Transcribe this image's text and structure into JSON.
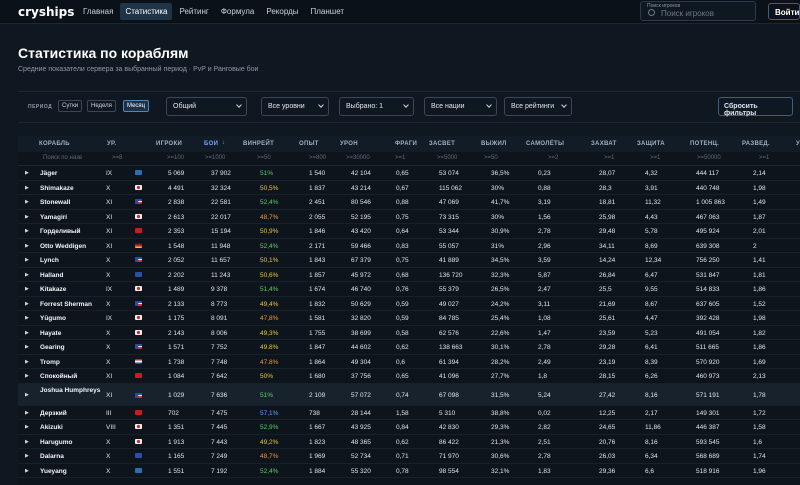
{
  "topbar": {
    "logo": "cryships",
    "nav": [
      "Главная",
      "Статистика",
      "Рейтинг",
      "Формула",
      "Рекорды",
      "Планшет"
    ],
    "active_nav": 1,
    "search_label": "Поиск игроков",
    "search_placeholder": "Поиск игроков",
    "login": "Войти"
  },
  "page": {
    "title": "Статистика по кораблям",
    "subtitle": "Средние показатели сервера за выбранный период · PvP и Ранговые бои"
  },
  "filters": {
    "period_label": "ПЕРИОД",
    "periods": [
      "Сутки",
      "Неделя",
      "Месяц"
    ],
    "active_period": 2,
    "selects": [
      "Общий",
      "Все уровни",
      "Выбрано: 1",
      "Все нации",
      "Все рейтинги"
    ],
    "reset": "Сбросить фильтры"
  },
  "table": {
    "headers": [
      "КОРАБЛЬ",
      "УР.",
      "ИГРОКИ",
      "БОИ",
      "ВИНРЕЙТ",
      "ОПЫТ",
      "УРОН",
      "ФРАГИ",
      "ЗАСВЕТ",
      "ВЫЖИЛ",
      "САМОЛЁТЫ",
      "ЗАХВАТ",
      "ЗАЩИТА",
      "ПОТЕНЦ.",
      "РАЗВЕД.",
      "У"
    ],
    "sort_arrow": "↓",
    "filters": [
      "Поиск по назв",
      ">=8",
      ">=100",
      ">=1000",
      ">=50",
      ">=800",
      ">=30000",
      ">=1",
      ">=5000",
      ">=50",
      ">=2",
      ">=1",
      ">=1",
      ">=50000",
      ">=1"
    ],
    "rows": [
      {
        "name": "Jäger",
        "tier": "IX",
        "flag": "pan-asia",
        "players": "5 069",
        "battles": "37 902",
        "wr": "51%",
        "wrc": "g",
        "exp": "1 540",
        "dmg": "42 104",
        "frags": "0,65",
        "spot": "53 074",
        "surv": "36,5%",
        "planes": "0,23",
        "cap": "28,07",
        "def": "4,32",
        "pot": "444 117",
        "scout": "2,14"
      },
      {
        "name": "Shimakaze",
        "tier": "X",
        "flag": "japan",
        "players": "4 491",
        "battles": "32 324",
        "wr": "50,5%",
        "wrc": "y",
        "exp": "1 837",
        "dmg": "43 214",
        "frags": "0,67",
        "spot": "115 062",
        "surv": "30%",
        "planes": "0,88",
        "cap": "28,3",
        "def": "3,91",
        "pot": "440 748",
        "scout": "1,98"
      },
      {
        "name": "Stonewall",
        "tier": "XI",
        "flag": "usa",
        "players": "2 838",
        "battles": "22 581",
        "wr": "52,4%",
        "wrc": "g",
        "exp": "2 451",
        "dmg": "80 546",
        "frags": "0,88",
        "spot": "47 069",
        "surv": "41,7%",
        "planes": "3,19",
        "cap": "18,81",
        "def": "11,32",
        "pot": "1 005 863",
        "scout": "1,49"
      },
      {
        "name": "Yamagiri",
        "tier": "XI",
        "flag": "japan",
        "players": "2 613",
        "battles": "22 017",
        "wr": "48,7%",
        "wrc": "o",
        "exp": "2 055",
        "dmg": "52 195",
        "frags": "0,75",
        "spot": "73 315",
        "surv": "30%",
        "planes": "1,56",
        "cap": "25,98",
        "def": "4,43",
        "pot": "467 063",
        "scout": "1,87"
      },
      {
        "name": "Горделивый",
        "tier": "XI",
        "flag": "ussr",
        "players": "2 353",
        "battles": "15 194",
        "wr": "50,9%",
        "wrc": "y",
        "exp": "1 846",
        "dmg": "43 420",
        "frags": "0,64",
        "spot": "53 344",
        "surv": "30,9%",
        "planes": "2,78",
        "cap": "29,48",
        "def": "5,78",
        "pot": "495 924",
        "scout": "2,01"
      },
      {
        "name": "Otto Weddigen",
        "tier": "XI",
        "flag": "germany",
        "players": "1 548",
        "battles": "11 948",
        "wr": "52,4%",
        "wrc": "g",
        "exp": "2 171",
        "dmg": "59 466",
        "frags": "0,83",
        "spot": "55 057",
        "surv": "31%",
        "planes": "2,96",
        "cap": "34,11",
        "def": "8,69",
        "pot": "639 308",
        "scout": "2"
      },
      {
        "name": "Lynch",
        "tier": "X",
        "flag": "usa",
        "players": "2 052",
        "battles": "11 657",
        "wr": "50,1%",
        "wrc": "y",
        "exp": "1 843",
        "dmg": "67 379",
        "frags": "0,75",
        "spot": "41 889",
        "surv": "34,5%",
        "planes": "3,59",
        "cap": "14,24",
        "def": "12,34",
        "pot": "756 250",
        "scout": "1,41"
      },
      {
        "name": "Halland",
        "tier": "X",
        "flag": "europe",
        "players": "2 202",
        "battles": "11 243",
        "wr": "50,6%",
        "wrc": "y",
        "exp": "1 857",
        "dmg": "45 972",
        "frags": "0,68",
        "spot": "136 720",
        "surv": "32,3%",
        "planes": "5,87",
        "cap": "26,84",
        "def": "6,47",
        "pot": "531 847",
        "scout": "1,81"
      },
      {
        "name": "Kitakaze",
        "tier": "IX",
        "flag": "japan",
        "players": "1 489",
        "battles": "9 378",
        "wr": "51,4%",
        "wrc": "g",
        "exp": "1 674",
        "dmg": "46 740",
        "frags": "0,76",
        "spot": "55 379",
        "surv": "26,5%",
        "planes": "2,47",
        "cap": "25,5",
        "def": "9,55",
        "pot": "514 833",
        "scout": "1,86"
      },
      {
        "name": "Forrest Sherman",
        "tier": "X",
        "flag": "usa",
        "players": "2 133",
        "battles": "8 773",
        "wr": "49,4%",
        "wrc": "y",
        "exp": "1 832",
        "dmg": "50 629",
        "frags": "0,59",
        "spot": "49 027",
        "surv": "24,2%",
        "planes": "3,11",
        "cap": "21,69",
        "def": "8,67",
        "pot": "637 605",
        "scout": "1,52"
      },
      {
        "name": "Yūgumo",
        "tier": "IX",
        "flag": "japan",
        "players": "1 175",
        "battles": "8 091",
        "wr": "47,8%",
        "wrc": "o",
        "exp": "1 581",
        "dmg": "32 820",
        "frags": "0,59",
        "spot": "84 785",
        "surv": "25,4%",
        "planes": "1,08",
        "cap": "25,61",
        "def": "4,47",
        "pot": "392 428",
        "scout": "1,98"
      },
      {
        "name": "Hayate",
        "tier": "X",
        "flag": "japan",
        "players": "2 143",
        "battles": "8 006",
        "wr": "49,3%",
        "wrc": "y",
        "exp": "1 755",
        "dmg": "38 699",
        "frags": "0,58",
        "spot": "62 576",
        "surv": "22,6%",
        "planes": "1,47",
        "cap": "23,59",
        "def": "5,23",
        "pot": "491 054",
        "scout": "1,82"
      },
      {
        "name": "Gearing",
        "tier": "X",
        "flag": "usa",
        "players": "1 571",
        "battles": "7 752",
        "wr": "49.8%",
        "wrc": "y",
        "exp": "1 847",
        "dmg": "44 602",
        "frags": "0,62",
        "spot": "138 663",
        "surv": "30,1%",
        "planes": "2,78",
        "cap": "29,28",
        "def": "6,41",
        "pot": "511 665",
        "scout": "1,86"
      },
      {
        "name": "Tromp",
        "tier": "X",
        "flag": "netherlands",
        "players": "1 738",
        "battles": "7 748",
        "wr": "47.8%",
        "wrc": "o",
        "exp": "1 864",
        "dmg": "49 304",
        "frags": "0,6",
        "spot": "61 394",
        "surv": "28,2%",
        "planes": "2,49",
        "cap": "23,19",
        "def": "8,39",
        "pot": "570 920",
        "scout": "1,69"
      },
      {
        "name": "Спокойный",
        "tier": "XI",
        "flag": "ussr",
        "players": "1 084",
        "battles": "7 642",
        "wr": "50%",
        "wrc": "y",
        "exp": "1 680",
        "dmg": "37 756",
        "frags": "0,65",
        "spot": "41 096",
        "surv": "27,7%",
        "planes": "1,8",
        "cap": "28,15",
        "def": "6,26",
        "pot": "460 973",
        "scout": "2,13"
      },
      {
        "name": "Joshua Humphreys",
        "tier": "XI",
        "flag": "usa",
        "players": "1 029",
        "battles": "7 636",
        "wr": "51%",
        "wrc": "g",
        "exp": "2 109",
        "dmg": "57 072",
        "frags": "0,74",
        "spot": "67 098",
        "surv": "31,5%",
        "planes": "5,24",
        "cap": "27,42",
        "def": "8,16",
        "pot": "571 191",
        "scout": "1,78",
        "hl": true
      },
      {
        "name": "Дерзкий",
        "tier": "III",
        "flag": "ussr",
        "players": "702",
        "battles": "7 475",
        "wr": "57,1%",
        "wrc": "b",
        "exp": "738",
        "dmg": "28 144",
        "frags": "1,58",
        "spot": "5 310",
        "surv": "38,8%",
        "planes": "0,02",
        "cap": "12,25",
        "def": "2,17",
        "pot": "149 301",
        "scout": "1,72"
      },
      {
        "name": "Akizuki",
        "tier": "VIII",
        "flag": "japan",
        "players": "1 351",
        "battles": "7 445",
        "wr": "52,9%",
        "wrc": "g",
        "exp": "1 667",
        "dmg": "43 925",
        "frags": "0,84",
        "spot": "42 830",
        "surv": "29,3%",
        "planes": "2,82",
        "cap": "24,65",
        "def": "11,86",
        "pot": "446 387",
        "scout": "1,58"
      },
      {
        "name": "Harugumo",
        "tier": "X",
        "flag": "japan",
        "players": "1 913",
        "battles": "7 443",
        "wr": "49,2%",
        "wrc": "y",
        "exp": "1 823",
        "dmg": "48 365",
        "frags": "0,62",
        "spot": "86 422",
        "surv": "21,3%",
        "planes": "2,51",
        "cap": "20,76",
        "def": "8,16",
        "pot": "593 545",
        "scout": "1,6"
      },
      {
        "name": "Dalarna",
        "tier": "X",
        "flag": "europe",
        "players": "1 165",
        "battles": "7 249",
        "wr": "48,7%",
        "wrc": "o",
        "exp": "1 969",
        "dmg": "52 734",
        "frags": "0,71",
        "spot": "71 970",
        "surv": "30,6%",
        "planes": "2,78",
        "cap": "26,03",
        "def": "6,34",
        "pot": "568 689",
        "scout": "1,74"
      },
      {
        "name": "Yueyang",
        "tier": "X",
        "flag": "pan-asia",
        "players": "1 551",
        "battles": "7 192",
        "wr": "52,4%",
        "wrc": "g",
        "exp": "1 884",
        "dmg": "55 320",
        "frags": "0,78",
        "spot": "98 554",
        "surv": "32,1%",
        "planes": "1,83",
        "cap": "29,36",
        "def": "6,6",
        "pot": "518 916",
        "scout": "1,96"
      }
    ]
  },
  "colors": {
    "green": "#5ad06a",
    "yellow": "#e9c840",
    "orange": "#f19a3c",
    "blue": "#5aa8ff",
    "accent": "#4d86c2"
  },
  "icons": {
    "expand": "triangle-right-icon",
    "search": "search-icon",
    "sort": "arrow-down-icon"
  }
}
